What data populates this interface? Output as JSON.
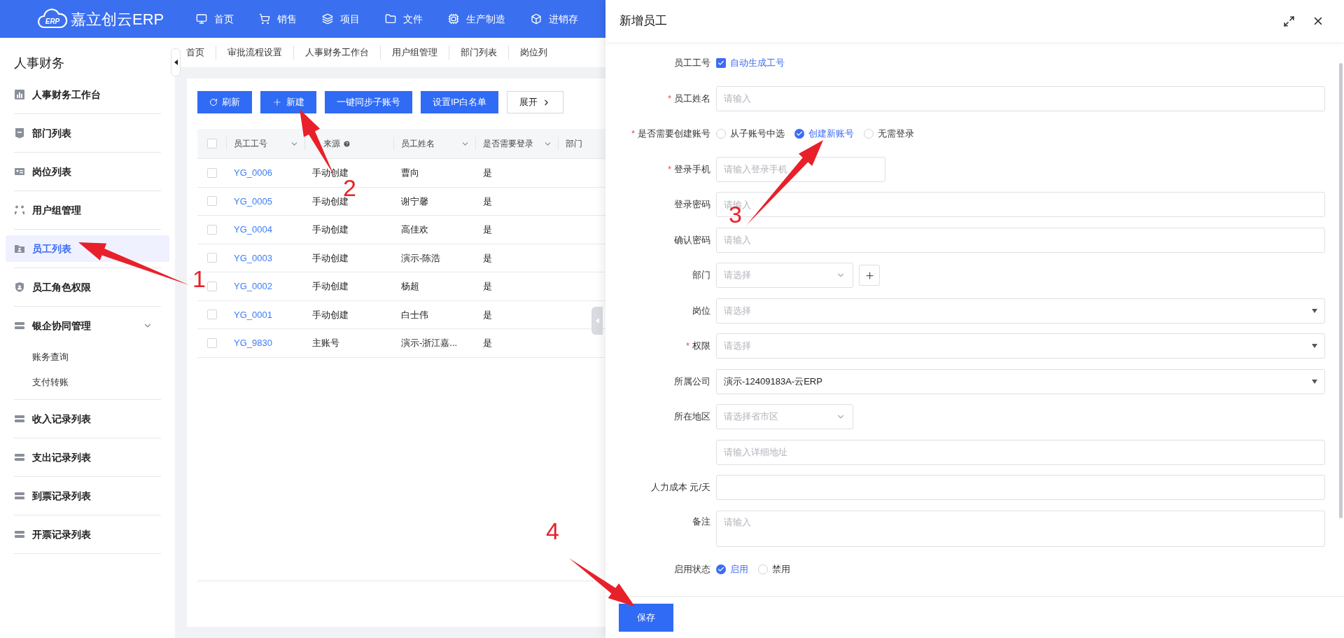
{
  "header": {
    "logo": {
      "badge": "ERP",
      "name": "嘉立创云ERP"
    },
    "nav": [
      {
        "label": "首页"
      },
      {
        "label": "销售"
      },
      {
        "label": "项目"
      },
      {
        "label": "文件"
      },
      {
        "label": "生产制造"
      },
      {
        "label": "进销存"
      }
    ]
  },
  "sidebar": {
    "title": "人事财务",
    "items": [
      {
        "label": "人事财务工作台",
        "selected": false
      },
      {
        "label": "部门列表",
        "selected": false
      },
      {
        "label": "岗位列表",
        "selected": false
      },
      {
        "label": "用户组管理",
        "selected": false
      },
      {
        "label": "员工列表",
        "selected": true
      },
      {
        "label": "员工角色权限",
        "selected": false
      },
      {
        "label": "银企协同管理",
        "selected": false,
        "expanded": true,
        "children": [
          {
            "label": "账务查询"
          },
          {
            "label": "支付转账"
          }
        ]
      },
      {
        "label": "收入记录列表",
        "selected": false
      },
      {
        "label": "支出记录列表",
        "selected": false
      },
      {
        "label": "到票记录列表",
        "selected": false
      },
      {
        "label": "开票记录列表",
        "selected": false
      }
    ]
  },
  "page_tabs": [
    {
      "label": "首页"
    },
    {
      "label": "审批流程设置"
    },
    {
      "label": "人事财务工作台"
    },
    {
      "label": "用户组管理"
    },
    {
      "label": "部门列表"
    },
    {
      "label": "岗位列"
    }
  ],
  "toolbar": [
    {
      "label": "刷新",
      "kind": "refresh"
    },
    {
      "label": "新建",
      "kind": "add"
    },
    {
      "label": "一键同步子账号",
      "kind": "primary"
    },
    {
      "label": "设置IP白名单",
      "kind": "primary"
    },
    {
      "label": "展开",
      "kind": "expand"
    }
  ],
  "table": {
    "all_checked": false,
    "columns": [
      {
        "label": "员工工号",
        "sortable": true
      },
      {
        "label": "来源",
        "help": true
      },
      {
        "label": "员工姓名",
        "sortable": true
      },
      {
        "label": "是否需要登录",
        "sortable": true
      },
      {
        "label": "部门"
      }
    ],
    "rows": [
      {
        "id": "YG_0006",
        "source": "手动创建",
        "name": "曹向",
        "login": "是",
        "checked": false
      },
      {
        "id": "YG_0005",
        "source": "手动创建",
        "name": "谢宁馨",
        "login": "是",
        "checked": false
      },
      {
        "id": "YG_0004",
        "source": "手动创建",
        "name": "高佳欢",
        "login": "是",
        "checked": false
      },
      {
        "id": "YG_0003",
        "source": "手动创建",
        "name": "演示-陈浩",
        "login": "是",
        "checked": false
      },
      {
        "id": "YG_0002",
        "source": "手动创建",
        "name": "杨超",
        "login": "是",
        "checked": false
      },
      {
        "id": "YG_0001",
        "source": "手动创建",
        "name": "白士伟",
        "login": "是",
        "checked": false
      },
      {
        "id": "YG_9830",
        "source": "主账号",
        "name": "演示-浙江嘉...",
        "login": "是",
        "checked": false
      }
    ]
  },
  "drawer": {
    "title": "新增员工",
    "fields": [
      {
        "label": "员工工号",
        "kind": "checkbox",
        "option": "自动生成工号",
        "checked": true
      },
      {
        "label": "员工姓名",
        "required_mark": "*",
        "kind": "text",
        "placeholder": "请输入"
      },
      {
        "label": "是否需要创建账号",
        "required_mark": "*",
        "kind": "radio",
        "options": [
          {
            "label": "从子账号中选",
            "selected": false
          },
          {
            "label": "创建新账号",
            "selected": true
          },
          {
            "label": "无需登录",
            "selected": false
          }
        ]
      },
      {
        "label": "登录手机",
        "required_mark": "*",
        "kind": "short",
        "placeholder": "请输入登录手机"
      },
      {
        "label": "登录密码",
        "kind": "text",
        "placeholder": "请输入"
      },
      {
        "label": "确认密码",
        "kind": "text",
        "placeholder": "请输入"
      },
      {
        "label": "部门",
        "kind": "cascader",
        "placeholder": "请选择",
        "with_add": true
      },
      {
        "label": "岗位",
        "kind": "select",
        "placeholder": "请选择"
      },
      {
        "label": "权限",
        "required_mark": "*",
        "kind": "select",
        "placeholder": "请选择"
      },
      {
        "label": "所属公司",
        "kind": "select",
        "value": "演示-12409183A-云ERP"
      },
      {
        "label": "所在地区",
        "kind": "cascader",
        "placeholder": "请选择省市区"
      },
      {
        "kind": "text",
        "placeholder": "请输入详细地址"
      },
      {
        "label": "人力成本 元/天",
        "kind": "text"
      },
      {
        "label": "备注",
        "kind": "textarea",
        "placeholder": "请输入"
      },
      {
        "label": "启用状态",
        "kind": "radio",
        "options": [
          {
            "label": "启用",
            "selected": true
          },
          {
            "label": "禁用",
            "selected": false
          }
        ]
      }
    ],
    "save": "保存"
  },
  "annotations": [
    {
      "label": "1"
    },
    {
      "label": "2"
    },
    {
      "label": "3"
    },
    {
      "label": "4"
    }
  ]
}
